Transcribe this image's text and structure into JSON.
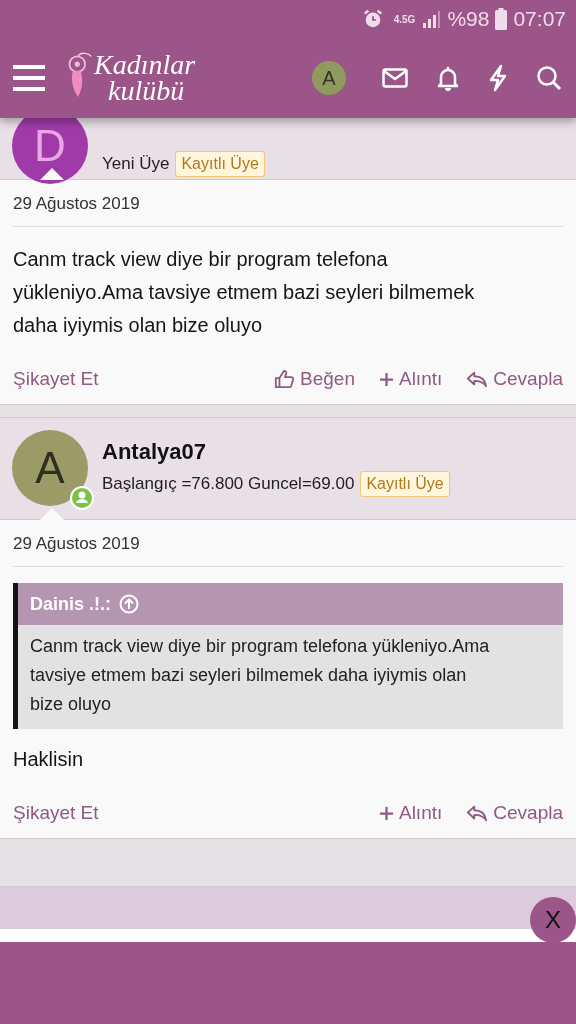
{
  "status_bar": {
    "network": "4.5G",
    "battery": "%98",
    "time": "07:07"
  },
  "header": {
    "logo_line1": "Kadınlar",
    "logo_line2": "kulübü",
    "account_letter": "A"
  },
  "posts": [
    {
      "avatar_letter": "D",
      "color": "#a03aa8",
      "online": false,
      "user_title": "Yeni Üye",
      "badge": "Kayıtlı Üye",
      "date": "29 Ağustos 2019",
      "text": "Canm track view diye bir program telefona yükleniyo.Ama tavsiye etmem bazi seyleri bilmemek daha iyiymis olan bize oluyo",
      "actions": [
        {
          "kind": "report",
          "label": "Şikayet Et"
        },
        {
          "kind": "like",
          "label": "Beğen"
        },
        {
          "kind": "quote",
          "label": "Alıntı"
        },
        {
          "kind": "reply",
          "label": "Cevapla"
        }
      ]
    },
    {
      "avatar_letter": "A",
      "color": "#9a9b67",
      "username": "Antalya07",
      "online": true,
      "user_title": "Başlangıç =76.800 Guncel=69.00",
      "badge": "Kayıtlı Üye",
      "date": "29 Ağustos 2019",
      "quote": {
        "author": "Dainis .!.:",
        "text": "Canm track view diye bir program telefona yükleniyo.Ama tavsiye etmem bazi seyleri bilmemek daha iyiymis olan bize oluyo"
      },
      "text": "Haklisin",
      "actions": [
        {
          "kind": "report",
          "label": "Şikayet Et"
        },
        {
          "kind": "quote",
          "label": "Alıntı"
        },
        {
          "kind": "reply",
          "label": "Cevapla"
        }
      ]
    }
  ],
  "close_button": "X"
}
